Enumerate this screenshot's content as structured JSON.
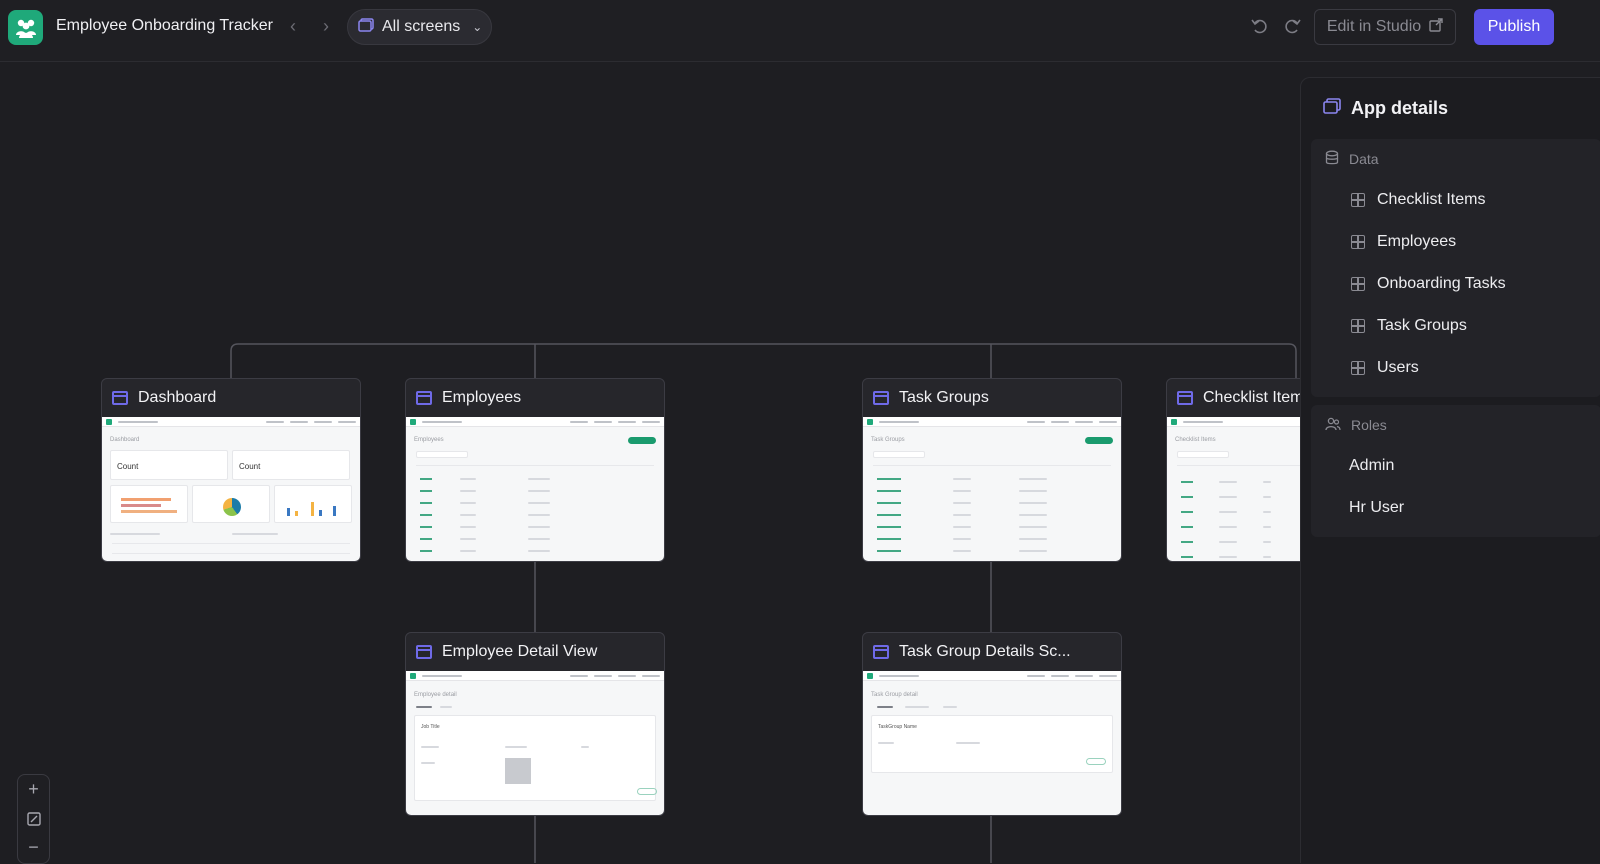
{
  "header": {
    "app_title": "Employee Onboarding Tracker",
    "screens_label": "All screens",
    "edit_label": "Edit in Studio",
    "publish_label": "Publish"
  },
  "cards": [
    {
      "label": "Dashboard",
      "preview_heading": "Dashboard",
      "preview_count_1": "Count",
      "preview_count_2": "Count"
    },
    {
      "label": "Employees",
      "preview_heading": "Employees"
    },
    {
      "label": "Task Groups",
      "preview_heading": "Task Groups"
    },
    {
      "label": "Checklist Items",
      "preview_heading": "Checklist Items"
    },
    {
      "label": "Employee Detail View",
      "preview_heading": "Employee detail",
      "preview_field": "Job Title"
    },
    {
      "label": "Task Group Details Sc...",
      "preview_heading": "Task Group detail",
      "preview_field": "TaskGroup Name"
    }
  ],
  "panel": {
    "title": "App details",
    "data_label": "Data",
    "data_items": [
      "Checklist Items",
      "Employees",
      "Onboarding Tasks",
      "Task Groups",
      "Users"
    ],
    "roles_label": "Roles",
    "roles": [
      "Admin",
      "Hr User"
    ]
  },
  "icons": {
    "logo": "people-group-icon",
    "screen": "screen-window-icon",
    "table": "table-grid-icon",
    "database": "database-icon",
    "roles": "users-icon"
  },
  "colors": {
    "accent": "#5b52e8",
    "brand": "#1fa97a",
    "screen_icon": "#6f6ae8"
  }
}
